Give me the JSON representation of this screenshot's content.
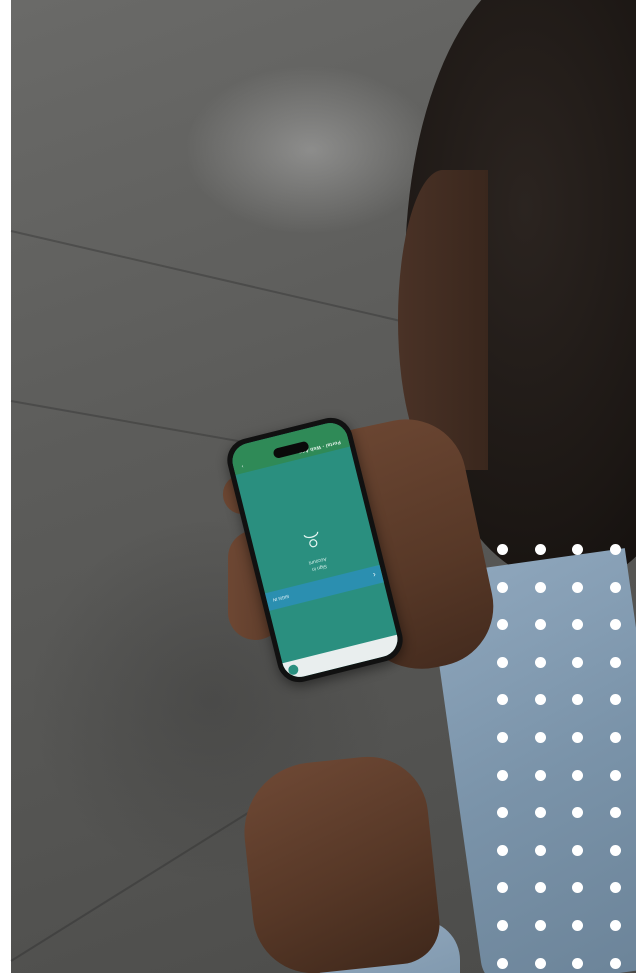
{
  "phone_app": {
    "title": "Portal - Web App",
    "content_line1": "Account",
    "content_line2": "Sign in",
    "action_label": "SIGN IN",
    "icon": "user-icon"
  },
  "decoration": {
    "dot_grid_columns": 4,
    "dot_grid_rows": 12,
    "dot_color": "#ffffff",
    "screen_color": "#2a8f7f",
    "header_color": "#2f8a57",
    "action_bar_color": "#2b8fb0"
  }
}
